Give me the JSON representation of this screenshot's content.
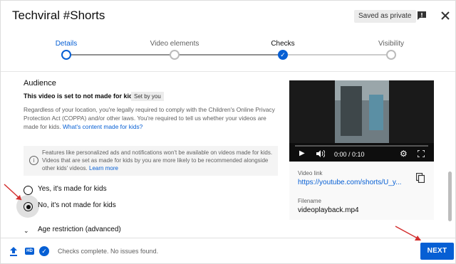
{
  "header": {
    "title": "Techviral #Shorts",
    "saved_badge": "Saved as private"
  },
  "stepper": {
    "steps": [
      {
        "label": "Details",
        "state": "current"
      },
      {
        "label": "Video elements",
        "state": "todo"
      },
      {
        "label": "Checks",
        "state": "done"
      },
      {
        "label": "Visibility",
        "state": "todo"
      }
    ]
  },
  "audience": {
    "heading": "Audience",
    "status": "This video is set to not made for kids",
    "set_by": "Set by you",
    "description": "Regardless of your location, you're legally required to comply with the Children's Online Privacy Protection Act (COPPA) and/or other laws. You're required to tell us whether your videos are made for kids.",
    "description_link": "What's content made for kids?",
    "info_text": "Features like personalized ads and notifications won't be available on videos made for kids. Videos that are set as made for kids by you are more likely to be recommended alongside other kids' videos.",
    "info_link": "Learn more",
    "options": [
      {
        "label": "Yes, it's made for kids",
        "checked": false
      },
      {
        "label": "No, it's not made for kids",
        "checked": true
      }
    ],
    "age_restriction": "Age restriction (advanced)"
  },
  "video_card": {
    "time": "0:00 / 0:10",
    "link_label": "Video link",
    "link": "https://youtube.com/shorts/U_y...",
    "filename_label": "Filename",
    "filename": "videoplayback.mp4"
  },
  "footer": {
    "status": "Checks complete. No issues found.",
    "next_label": "NEXT"
  },
  "colors": {
    "accent": "#065fd4",
    "annotation_arrow": "#d32f2f"
  }
}
